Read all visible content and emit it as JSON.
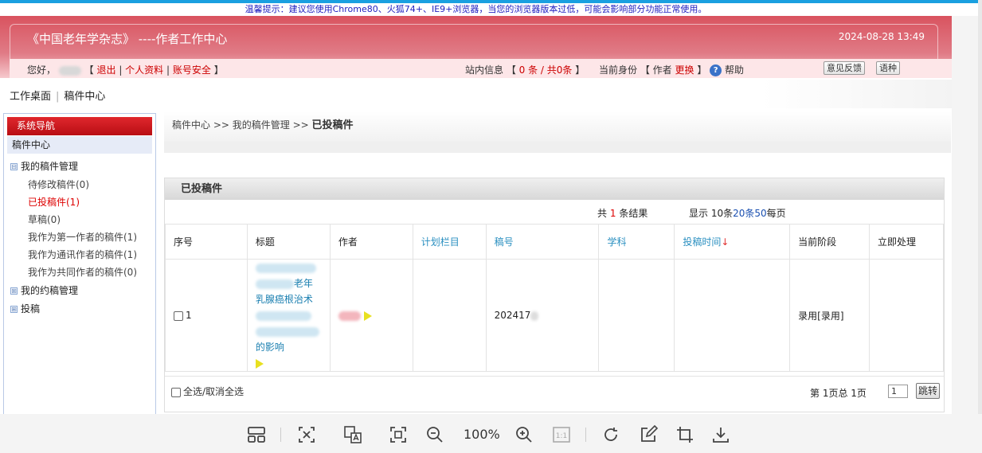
{
  "browser_notice": "温馨提示：建议您使用Chrome80、火狐74+、IE9+浏览器，当您的浏览器版本过低，可能会影响部分功能正常使用。",
  "header": {
    "title": "《中国老年学杂志》 ----作者工作中心",
    "datetime": "2024-08-28 13:49"
  },
  "userbar": {
    "greeting": "您好，",
    "logout": "退出",
    "profile": "个人资料",
    "account_security": "账号安全",
    "messages_label": "站内信息",
    "messages_count": "0 条 / 共0条",
    "role_label": "当前身份",
    "role_value": "作者",
    "role_switch": "更换",
    "help": "帮助",
    "feedback_button": "意见反馈",
    "language_button": "语种"
  },
  "top_crumb": {
    "desk": "工作桌面",
    "center": "稿件中心"
  },
  "sidebar": {
    "heading": "系统导航",
    "section": "稿件中心",
    "groups": [
      {
        "label": "我的稿件管理",
        "expander": "⊟"
      },
      {
        "label": "我的约稿管理",
        "expander": "⊞"
      },
      {
        "label": "投稿",
        "expander": "⊞"
      }
    ],
    "items": [
      {
        "label": "待修改稿件(0)"
      },
      {
        "label": "已投稿件(1)"
      },
      {
        "label": "草稿(0)"
      },
      {
        "label": "我作为第一作者的稿件(1)"
      },
      {
        "label": "我作为通讯作者的稿件(1)"
      },
      {
        "label": "我作为共同作者的稿件(0)"
      }
    ]
  },
  "content": {
    "breadcrumb_1": "稿件中心",
    "breadcrumb_2": "我的稿件管理",
    "breadcrumb_current": "已投稿件",
    "panel_title": "已投稿件",
    "results_prefix": "共",
    "results_count": "1",
    "results_suffix": "条结果",
    "perpage_prefix": "显示 10条",
    "perpage_20": "20条",
    "perpage_50": "50",
    "perpage_suffix": "每页",
    "columns": [
      "序号",
      "标题",
      "作者",
      "计划栏目",
      "稿号",
      "学科",
      "投稿时间",
      "当前阶段",
      "立即处理"
    ],
    "sort_arrow": "↓",
    "row": {
      "index": "1",
      "title_part_1": "老年",
      "title_part_2": "乳腺癌根治术",
      "title_part_3": "的影响",
      "manuscript_no": "202417",
      "stage": "录用[录用]"
    },
    "select_all": "全选/取消全选",
    "pager_text": "第 1页总 1页",
    "page_input_value": "1",
    "jump_button": "跳转"
  },
  "viewer": {
    "zoom": "100%",
    "icons": [
      "layout-icon",
      "fit-icon",
      "translate-icon",
      "fullscreen-icon",
      "zoom-out-icon",
      "zoom-in-icon",
      "actual-size-icon",
      "rotate-icon",
      "edit-icon",
      "crop-icon",
      "download-icon"
    ]
  }
}
